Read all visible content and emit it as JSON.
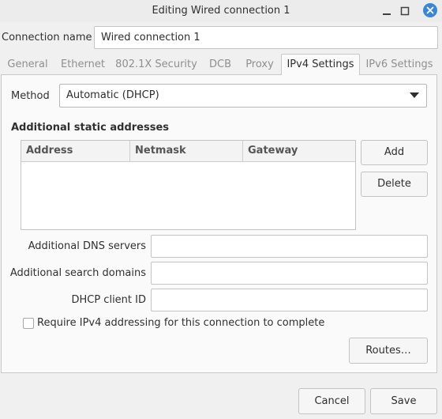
{
  "window": {
    "title": "Editing Wired connection 1"
  },
  "connection_name": {
    "label": "Connection name",
    "value": "Wired connection 1"
  },
  "tabs": [
    {
      "label": "General"
    },
    {
      "label": "Ethernet"
    },
    {
      "label": "802.1X Security"
    },
    {
      "label": "DCB"
    },
    {
      "label": "Proxy"
    },
    {
      "label": "IPv4 Settings"
    },
    {
      "label": "IPv6 Settings"
    }
  ],
  "active_tab": "IPv4 Settings",
  "method": {
    "label": "Method",
    "value": "Automatic (DHCP)"
  },
  "static_addresses": {
    "heading": "Additional static addresses",
    "columns": [
      "Address",
      "Netmask",
      "Gateway"
    ],
    "add_label": "Add",
    "delete_label": "Delete"
  },
  "dns": {
    "label": "Additional DNS servers",
    "value": ""
  },
  "search_domains": {
    "label": "Additional search domains",
    "value": ""
  },
  "dhcp_client_id": {
    "label": "DHCP client ID",
    "value": ""
  },
  "require_ipv4": {
    "label": "Require IPv4 addressing for this connection to complete",
    "checked": false
  },
  "routes_label": "Routes…",
  "footer": {
    "cancel_label": "Cancel",
    "save_label": "Save"
  },
  "colors": {
    "accent": "#3a86d6"
  },
  "icons": {
    "minimize": "minimize-icon",
    "maximize": "maximize-icon",
    "close": "close-icon",
    "dropdown": "triangle-down-icon"
  }
}
